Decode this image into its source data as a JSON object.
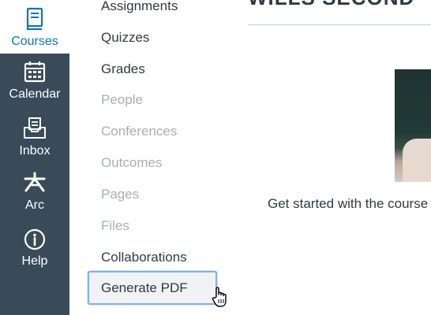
{
  "global_nav": {
    "items": [
      {
        "label": "Courses",
        "icon": "book-icon",
        "active": true
      },
      {
        "label": "Calendar",
        "icon": "calendar-icon"
      },
      {
        "label": "Inbox",
        "icon": "inbox-icon"
      },
      {
        "label": "Arc",
        "icon": "arc-icon"
      },
      {
        "label": "Help",
        "icon": "info-icon"
      }
    ],
    "colors": {
      "background": "#394b58",
      "active_text": "#0b74b8"
    }
  },
  "course_nav": {
    "items": [
      {
        "label": "Assignments",
        "enabled": true
      },
      {
        "label": "Quizzes",
        "enabled": true
      },
      {
        "label": "Grades",
        "enabled": true
      },
      {
        "label": "People",
        "enabled": false
      },
      {
        "label": "Conferences",
        "enabled": false
      },
      {
        "label": "Outcomes",
        "enabled": false
      },
      {
        "label": "Pages",
        "enabled": false
      },
      {
        "label": "Files",
        "enabled": false
      },
      {
        "label": "Collaborations",
        "enabled": true
      },
      {
        "label": "Generate PDF",
        "enabled": true,
        "focused": true
      }
    ]
  },
  "main": {
    "title": "WILLS SECOND",
    "get_started_text": "Get started with the course"
  }
}
